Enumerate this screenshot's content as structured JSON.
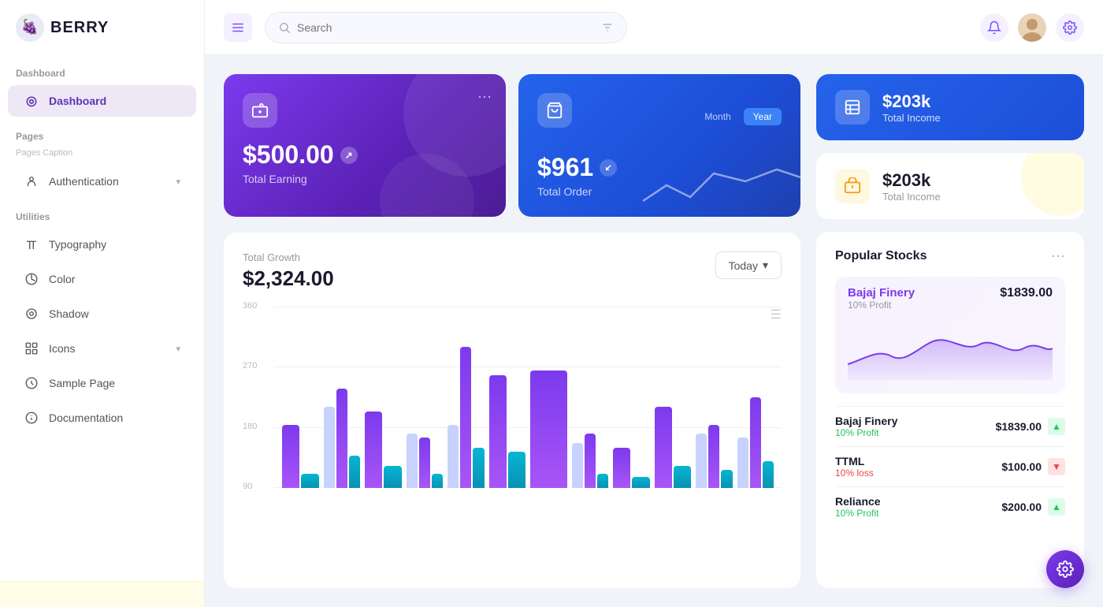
{
  "app": {
    "name": "BERRY"
  },
  "topbar": {
    "menu_label": "☰",
    "search_placeholder": "Search",
    "filter_icon": "⚙",
    "bell_icon": "🔔",
    "settings_icon": "⚙",
    "avatar_emoji": "👤"
  },
  "sidebar": {
    "section_dashboard": "Dashboard",
    "item_dashboard": "Dashboard",
    "section_pages": "Pages",
    "section_pages_caption": "Pages Caption",
    "item_authentication": "Authentication",
    "section_utilities": "Utilities",
    "item_typography": "Typography",
    "item_color": "Color",
    "item_shadow": "Shadow",
    "item_icons": "Icons",
    "item_sample_page": "Sample Page",
    "item_documentation": "Documentation"
  },
  "cards": {
    "earning": {
      "amount": "$500.00",
      "label": "Total Earning"
    },
    "order": {
      "amount": "$961",
      "label": "Total Order",
      "toggle_month": "Month",
      "toggle_year": "Year"
    },
    "income_blue": {
      "amount": "$203k",
      "label": "Total Income"
    },
    "income_white": {
      "amount": "$203k",
      "label": "Total Income"
    }
  },
  "growth": {
    "label": "Total Growth",
    "amount": "$2,324.00",
    "today_btn": "Today",
    "grid_labels": [
      "360",
      "270",
      "180",
      "90"
    ],
    "bars": [
      {
        "purple": 35,
        "teal": 8,
        "light": 0
      },
      {
        "purple": 55,
        "teal": 18,
        "light": 45
      },
      {
        "purple": 42,
        "teal": 12,
        "light": 0
      },
      {
        "purple": 28,
        "teal": 8,
        "light": 30
      },
      {
        "purple": 78,
        "teal": 22,
        "light": 35
      },
      {
        "purple": 62,
        "teal": 20,
        "light": 0
      },
      {
        "purple": 65,
        "teal": 0,
        "light": 0
      },
      {
        "purple": 30,
        "teal": 8,
        "light": 25
      },
      {
        "purple": 22,
        "teal": 6,
        "light": 0
      },
      {
        "purple": 45,
        "teal": 12,
        "light": 0
      },
      {
        "purple": 35,
        "teal": 10,
        "light": 30
      },
      {
        "purple": 50,
        "teal": 15,
        "light": 28
      }
    ]
  },
  "stocks": {
    "title": "Popular Stocks",
    "featured": {
      "name": "Bajaj Finery",
      "profit": "10% Profit",
      "price": "$1839.00"
    },
    "list": [
      {
        "name": "Bajaj Finery",
        "profit": "10% Profit",
        "profit_type": "up",
        "price": "$1839.00",
        "direction": "up"
      },
      {
        "name": "TTML",
        "profit": "10% loss",
        "profit_type": "down",
        "price": "$100.00",
        "direction": "down"
      },
      {
        "name": "Reliance",
        "profit": "10% Profit",
        "profit_type": "up",
        "price": "$200.00",
        "direction": "up"
      }
    ]
  },
  "fab": {
    "icon": "⚙"
  }
}
